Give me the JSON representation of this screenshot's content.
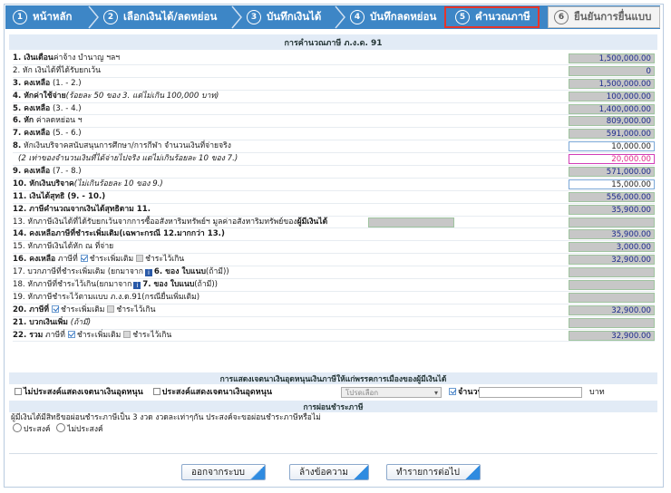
{
  "steps": [
    {
      "num": "1",
      "label": "หน้าหลัก"
    },
    {
      "num": "2",
      "label": "เลือกเงินได้/ลดหย่อน"
    },
    {
      "num": "3",
      "label": "บันทึกเงินได้"
    },
    {
      "num": "4",
      "label": "บันทึกลดหย่อน"
    },
    {
      "num": "5",
      "label": "คำนวณภาษี"
    },
    {
      "num": "6",
      "label": "ยืนยันการยื่นแบบ"
    }
  ],
  "panel_title": "การคำนวณภาษี ภ.ง.ด. 91",
  "rows": [
    {
      "bold": "1. เงินเดือน",
      "text": "ค่าจ้าง บำนาญ ฯลฯ",
      "value": "1,500,000.00"
    },
    {
      "bold": "",
      "text": "2. หัก เงินได้ที่ได้รับยกเว้น",
      "value": "0"
    },
    {
      "bold": "3. คงเหลือ",
      "text": " (1. - 2.)",
      "value": "1,500,000.00"
    },
    {
      "bold": "4. หักค่าใช้จ่าย",
      "italic": "(ร้อยละ 50 ของ 3. แต่ไม่เกิน 100,000 บาท)",
      "text": "",
      "value": "100,000.00"
    },
    {
      "bold": "5. คงเหลือ",
      "text": " (3. - 4.)",
      "value": "1,400,000.00"
    },
    {
      "bold": "6. หัก",
      "text": " ค่าลดหย่อน ฯ",
      "value": "809,000.00"
    },
    {
      "bold": "7. คงเหลือ",
      "text": " (5. - 6.)",
      "value": "591,000.00"
    },
    {
      "bold": "8.",
      "text": " หักเงินบริจาคสนับสนุนการศึกษา/การกีฬา จำนวนเงินที่จ่ายจริง",
      "value": "10,000.00"
    },
    {
      "bold": "",
      "italic": "(2 เท่าของจำนวนเงินที่ได้จ่ายไปจริง แต่ไม่เกินร้อยละ 10 ของ 7.)",
      "text": "",
      "value": "20,000.00"
    },
    {
      "bold": "9. คงเหลือ",
      "text": " (7. - 8.)",
      "value": "571,000.00"
    },
    {
      "bold": "10. หักเงินบริจาค",
      "italic": "(ไม่เกินร้อยละ 10 ของ 9.)",
      "text": "",
      "value": "15,000.00"
    },
    {
      "bold": "11. เงินได้สุทธิ (9. - 10.)",
      "text": "",
      "value": "556,000.00"
    },
    {
      "bold": "12. ภาษีคำนวณจากเงินได้สุทธิตาม 11.",
      "text": "",
      "value": "35,900.00"
    },
    {
      "bold": "",
      "text": "13. หักภาษีเงินได้ที่ได้รับยกเว้นจากการซื้ออสังหาริมทรัพย์ฯ มูลค่าอสังหาริมทรัพย์ของ",
      "bold2": "ผู้มีเงินได้",
      "value": ""
    },
    {
      "bold": "14. คงเหลือภาษีที่ชำระเพิ่มเติม(เฉพาะกรณี 12.มากกว่า 13.)",
      "text": "",
      "value": "35,900.00"
    },
    {
      "bold": "",
      "text": "15. หักภาษีเงินได้หัก ณ ที่จ่าย",
      "value": "3,000.00"
    },
    {
      "bold": "16. คงเหลือ",
      "text": " ภาษีที่",
      "check1": "ชำระเพิ่มเติม",
      "check2": "ชำระไว้เกิน",
      "value": "32,900.00"
    },
    {
      "bold": "",
      "text": "17. บวกภาษีที่ชำระเพิ่มเติม (ยกมาจาก",
      "flag": "6. ของ ใบแนบ",
      "tail": "(ถ้ามี))",
      "value": ""
    },
    {
      "bold": "",
      "text": "18. หักภาษีที่ชำระไว้เกิน(ยกมาจาก",
      "flag": "7. ของ ใบแนบ",
      "tail": "(ถ้ามี))",
      "value": ""
    },
    {
      "bold": "",
      "text": "19. หักภาษีชำระไว้ตามแบบ ภ.ง.ด.91(กรณียื่นเพิ่มเติม)",
      "value": ""
    },
    {
      "bold": "20. ภาษีที่",
      "text": "",
      "check1": "ชำระเพิ่มเติม",
      "check2": "ชำระไว้เกิน",
      "value": "32,900.00"
    },
    {
      "bold": "21. บวกเงินเพิ่ม",
      "italic": " (ถ้ามี)",
      "text": "",
      "value": ""
    },
    {
      "bold": "22. รวม",
      "text": " ภาษีที่",
      "check1": "ชำระเพิ่มเติม",
      "check2": "ชำระไว้เกิน",
      "value": "32,900.00"
    }
  ],
  "donation_section": {
    "title": "การแสดงเจตนาเงินอุดหนุนเงินภาษีให้แก่พรรคการเมืองของผู้มีเงินได้",
    "opt_no": "ไม่ประสงค์แสดงเจตนาเงินอุดหนุน",
    "opt_yes": "ประสงค์แสดงเจตนาเงินอุดหนุน",
    "select_placeholder": "โปรดเลือก",
    "amount_label": "จำนวน",
    "unit": "บาท"
  },
  "installment_section": {
    "title": "การผ่อนชำระภาษี",
    "desc": "ผู้มีเงินได้มีสิทธิขอผ่อนชำระภาษีเป็น 3 งวด งวดละเท่าๆกัน ประสงค์จะขอผ่อนชำระภาษีหรือไม่",
    "opt_yes": "ประสงค์",
    "opt_no": "ไม่ประสงค์"
  },
  "buttons": {
    "exit": "ออกจากระบบ",
    "clear": "ล้างข้อความ",
    "next": "ทำรายการต่อไป"
  }
}
